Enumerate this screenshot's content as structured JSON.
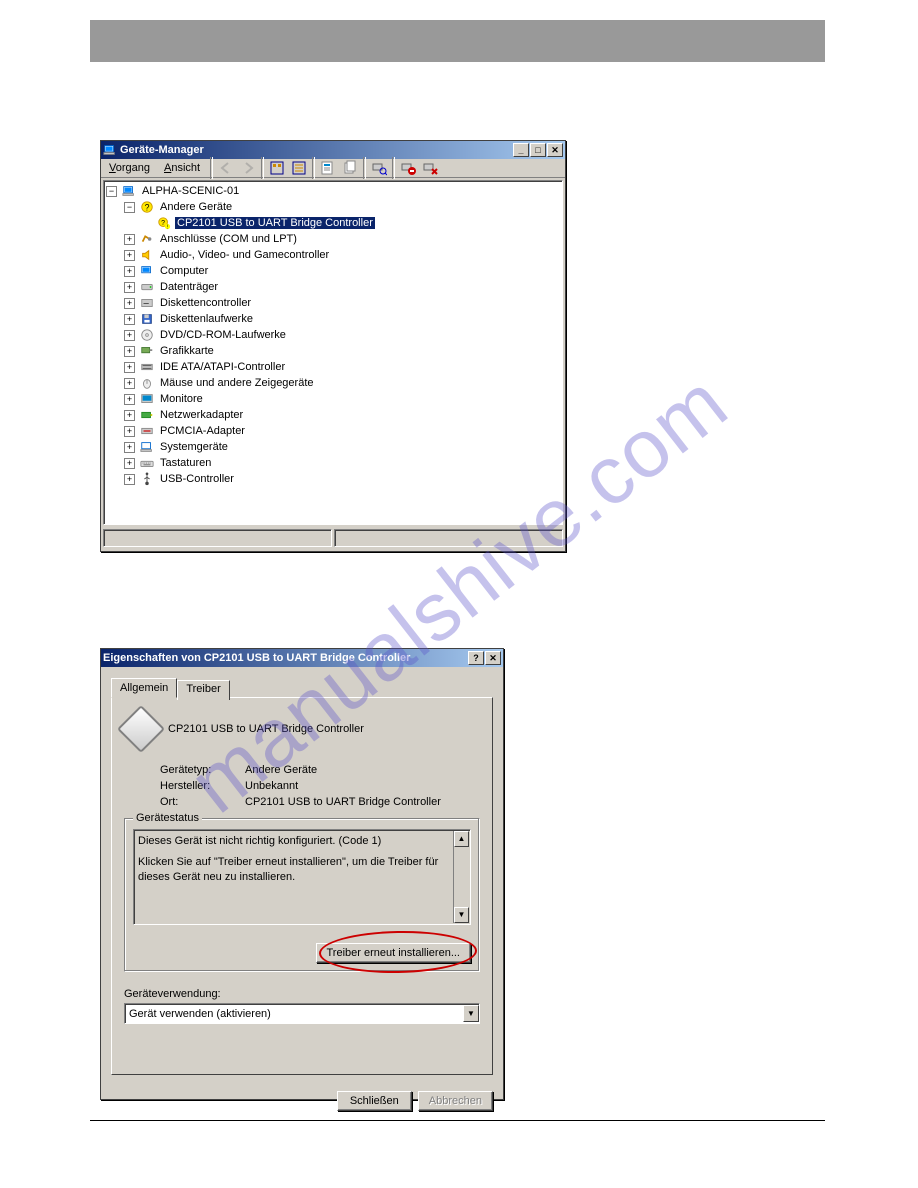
{
  "watermark": "manualshive.com",
  "device_manager": {
    "title": "Geräte-Manager",
    "menu": {
      "action": "Vorgang",
      "view": "Ansicht"
    },
    "tree": {
      "root": "ALPHA-SCENIC-01",
      "other_devices": "Andere Geräte",
      "selected_device": "CP2101 USB to UART Bridge Controller",
      "categories": [
        "Anschlüsse (COM und LPT)",
        "Audio-, Video- und Gamecontroller",
        "Computer",
        "Datenträger",
        "Diskettencontroller",
        "Diskettenlaufwerke",
        "DVD/CD-ROM-Laufwerke",
        "Grafikkarte",
        "IDE ATA/ATAPI-Controller",
        "Mäuse und andere Zeigegeräte",
        "Monitore",
        "Netzwerkadapter",
        "PCMCIA-Adapter",
        "Systemgeräte",
        "Tastaturen",
        "USB-Controller"
      ]
    }
  },
  "props": {
    "title": "Eigenschaften von CP2101 USB to UART Bridge Controller",
    "tabs": {
      "general": "Allgemein",
      "driver": "Treiber"
    },
    "device_name": "CP2101 USB to UART Bridge Controller",
    "rows": {
      "type_label": "Gerätetyp:",
      "type_value": "Andere Geräte",
      "mfr_label": "Hersteller:",
      "mfr_value": "Unbekannt",
      "loc_label": "Ort:",
      "loc_value": "CP2101 USB to UART Bridge Controller"
    },
    "status_group": "Gerätestatus",
    "status_line1": "Dieses Gerät ist nicht richtig konfiguriert. (Code 1)",
    "status_line2": "Klicken Sie auf \"Treiber erneut installieren\", um die Treiber für dieses Gerät neu zu installieren.",
    "reinstall_btn": "Treiber erneut installieren...",
    "usage_label": "Geräteverwendung:",
    "usage_value": "Gerät verwenden (aktivieren)",
    "close_btn": "Schließen",
    "cancel_btn": "Abbrechen"
  }
}
